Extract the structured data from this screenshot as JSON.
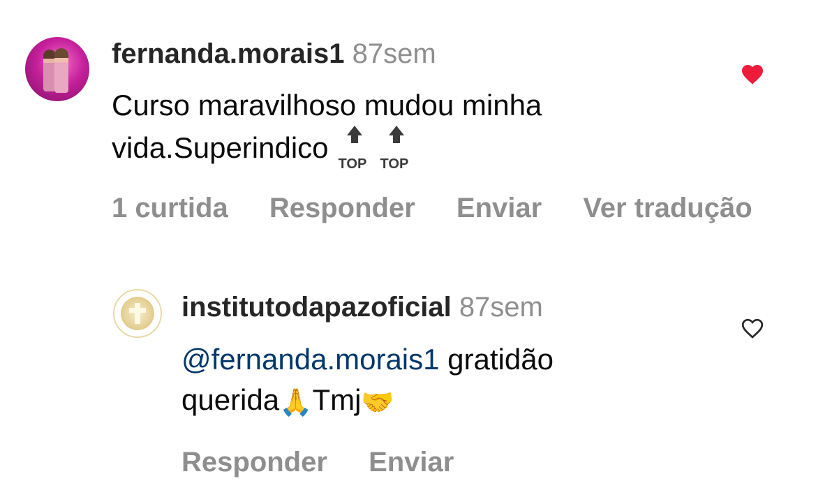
{
  "comment": {
    "username": "fernanda.morais1",
    "time": "87sem",
    "text_line1": "Curso maravilhoso mudou minha",
    "text_line2": "vida.Superindico",
    "top_badge_label": "TOP",
    "liked": true,
    "heart_color": "#ed1c3b",
    "actions": {
      "likes": "1 curtida",
      "reply": "Responder",
      "send": "Enviar",
      "translate": "Ver tradução"
    }
  },
  "reply": {
    "username": "institutodapazoficial",
    "time": "87sem",
    "mention": "@fernanda.morais1",
    "text_after_mention": " gratidão",
    "text_line2_a": "querida",
    "emoji_pray": "🙏",
    "text_line2_b": "Tmj",
    "emoji_handshake": "🤝",
    "liked": false,
    "actions": {
      "reply": "Responder",
      "send": "Enviar"
    }
  },
  "colors": {
    "mention": "#00376b",
    "muted": "#8e8e8e"
  }
}
